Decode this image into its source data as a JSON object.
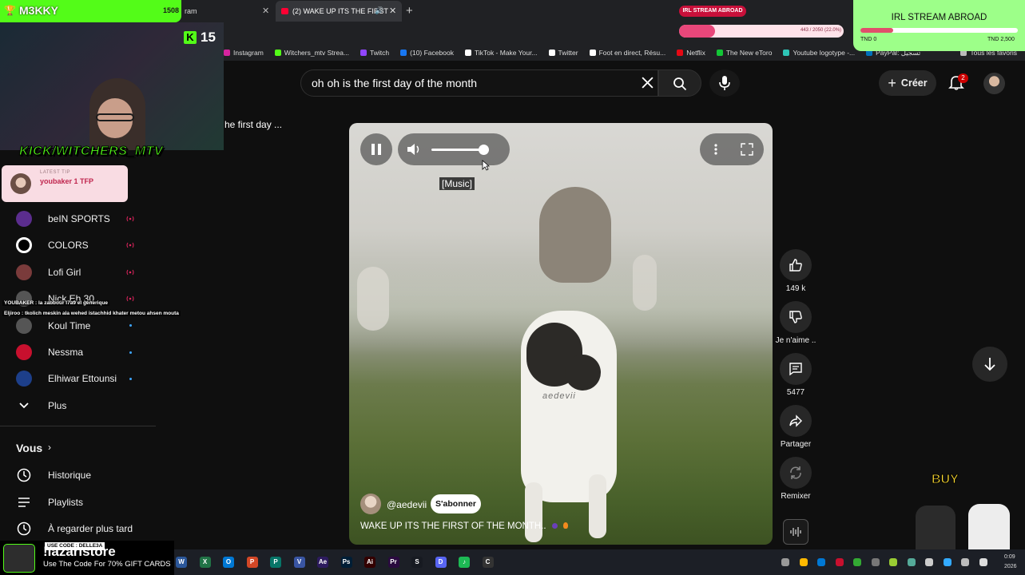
{
  "browser": {
    "tab_partial_label": "ram",
    "active_tab_label": "(2) WAKE UP ITS THE FIRST",
    "bookmarks": [
      {
        "label": "Instagram",
        "color": "#d6249f"
      },
      {
        "label": "Witchers_mtv Strea...",
        "color": "#53fc18"
      },
      {
        "label": "Twitch",
        "color": "#9146ff"
      },
      {
        "label": "(10) Facebook",
        "color": "#1877f2"
      },
      {
        "label": "TikTok - Make Your...",
        "color": "#ffffff"
      },
      {
        "label": "Twitter",
        "color": "#ffffff"
      },
      {
        "label": "Foot en direct, Résu...",
        "color": "#ffffff"
      },
      {
        "label": "Netflix",
        "color": "#e50914"
      },
      {
        "label": "The New eToro",
        "color": "#13c636"
      },
      {
        "label": "Youtube logotype -...",
        "color": "#2ec4b6"
      },
      {
        "label": "PayPal: تسجيل",
        "color": "#0070ba"
      },
      {
        "label": "Tous les favoris",
        "color": "#bbbbbb"
      }
    ]
  },
  "header": {
    "search_query": "oh oh is the first day of the month",
    "create_label": "Créer",
    "notification_count": "2"
  },
  "previous_video_title": "he first day ...",
  "sidebar": {
    "items": [
      {
        "label": "beIN SPORTS",
        "icon": "bein-icon",
        "indicator": "live"
      },
      {
        "label": "COLORS",
        "icon": "colors-icon",
        "indicator": "live"
      },
      {
        "label": "Lofi Girl",
        "icon": "lofi-icon",
        "indicator": "live"
      },
      {
        "label": "Nick Eh 30",
        "icon": "channel-icon",
        "indicator": "live"
      },
      {
        "label": "Koul Time",
        "icon": "channel-icon",
        "indicator": "dot"
      },
      {
        "label": "Nessma",
        "icon": "nessma-icon",
        "indicator": "dot"
      },
      {
        "label": "Elhiwar Ettounsi",
        "icon": "elhiwar-icon",
        "indicator": "dot"
      },
      {
        "label": "Plus",
        "icon": "chevron-down-icon",
        "indicator": "none"
      }
    ],
    "you_label": "Vous",
    "you_items": [
      {
        "label": "Historique",
        "icon": "history-icon"
      },
      {
        "label": "Playlists",
        "icon": "playlist-icon"
      },
      {
        "label": "À regarder plus tard",
        "icon": "watch-later-icon"
      }
    ]
  },
  "player": {
    "caption": "[Music]",
    "watermark": "aedevii",
    "channel_handle": "@aedevii",
    "subscribe_label": "S'abonner",
    "video_title": "WAKE UP ITS THE FIRST OF THE MONTH..",
    "volume_level": 0.9
  },
  "actions": {
    "like_count": "149 k",
    "dislike_label": "Je n'aime ..",
    "comment_count": "5477",
    "share_label": "Partager",
    "remix_label": "Remixer"
  },
  "overlay": {
    "top_badge_name": "M3KKY",
    "top_badge_count": "1508",
    "kick_follower_count": "15",
    "kick_handle": "KICK/WITCHERS_MTV",
    "latest_tip_label": "LATEST TIP",
    "latest_tip_text": "youbaker 1 TFP",
    "chat_line_1": "YOUBAKER : la zabbour l7a9 el generique",
    "chat_line_2": "Eljiroo : tkolich meskin ala wehed istachhid khater metou ahsen mouta",
    "irl_goal_chip": "IRL STREAM ABROAD",
    "irl_title": "IRL STREAM ABROAD",
    "irl_min": "TND 0",
    "irl_max": "TND 2,500",
    "irl_progress": 0.21,
    "goal_bar_text": "443 / 2050 (22.0%)",
    "goal_progress": 0.22,
    "buy_label": "BUY",
    "promo_code_label": "USE CODE : DELLE3A",
    "promo_store": "!lazaristore",
    "promo_line": "Use The Code For 70% GIFT CARDS"
  },
  "taskbar": {
    "time": "0:09",
    "date": "2026"
  }
}
